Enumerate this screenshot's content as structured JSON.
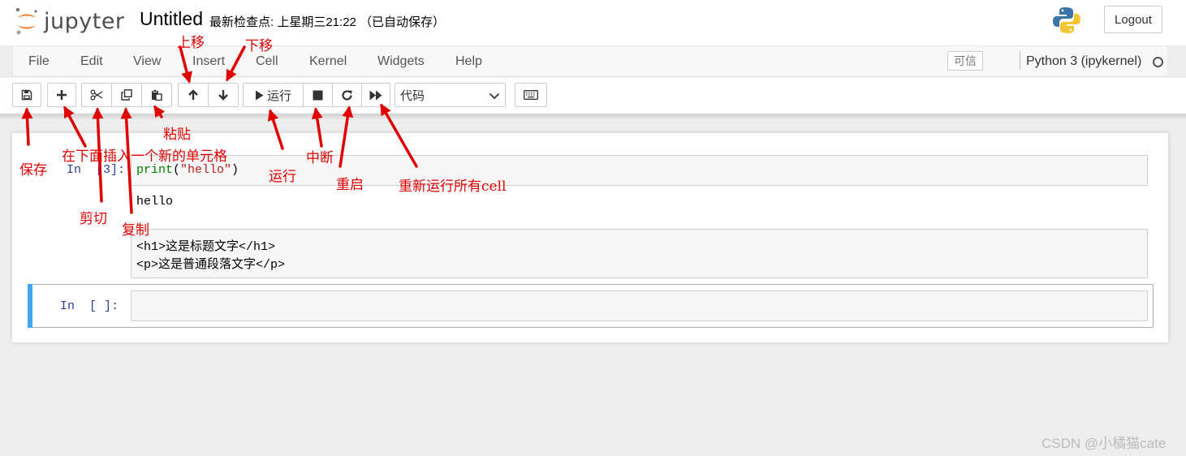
{
  "header": {
    "logo_text": "jupyter",
    "notebook_title": "Untitled",
    "checkpoint": "最新检查点: 上星期三21:22 （已自动保存）",
    "logout_label": "Logout"
  },
  "menu": {
    "items": [
      "File",
      "Edit",
      "View",
      "Insert",
      "Cell",
      "Kernel",
      "Widgets",
      "Help"
    ],
    "trusted_label": "可信",
    "kernel_name": "Python 3 (ipykernel)"
  },
  "toolbar": {
    "run_label": "运行",
    "cell_type": "代码",
    "icons": [
      "save-icon",
      "plus-icon",
      "cut-icon",
      "copy-icon",
      "paste-icon",
      "arrow-up-icon",
      "arrow-down-icon",
      "play-icon",
      "stop-icon",
      "restart-icon",
      "fast-forward-icon",
      "keyboard-icon"
    ]
  },
  "cells": {
    "cell1": {
      "prompt": "In  [3]:",
      "code_fn": "print",
      "code_open": "(",
      "code_str": "\"hello\"",
      "code_close": ")",
      "output": "hello"
    },
    "cell2": {
      "line1": "<h1>这是标题文字</h1>",
      "line2": "<p>这是普通段落文字</p>"
    },
    "cell3": {
      "prompt": "In  [ ]:"
    }
  },
  "annotations": {
    "save": "保存",
    "insert_below": "在下面插入一个新的单元格",
    "cut": "剪切",
    "copy": "复制",
    "paste": "粘贴",
    "move_up": "上移",
    "move_down": "下移",
    "run": "运行",
    "interrupt": "中断",
    "restart": "重启",
    "rerun_all": "重新运行所有cell"
  },
  "watermark": "CSDN @小橘猫cate",
  "colors": {
    "annotation_red": "#e00000",
    "active_cell_bar": "#42a5f5",
    "prompt_blue": "#303f9f",
    "logo_orange": "#f37726"
  }
}
